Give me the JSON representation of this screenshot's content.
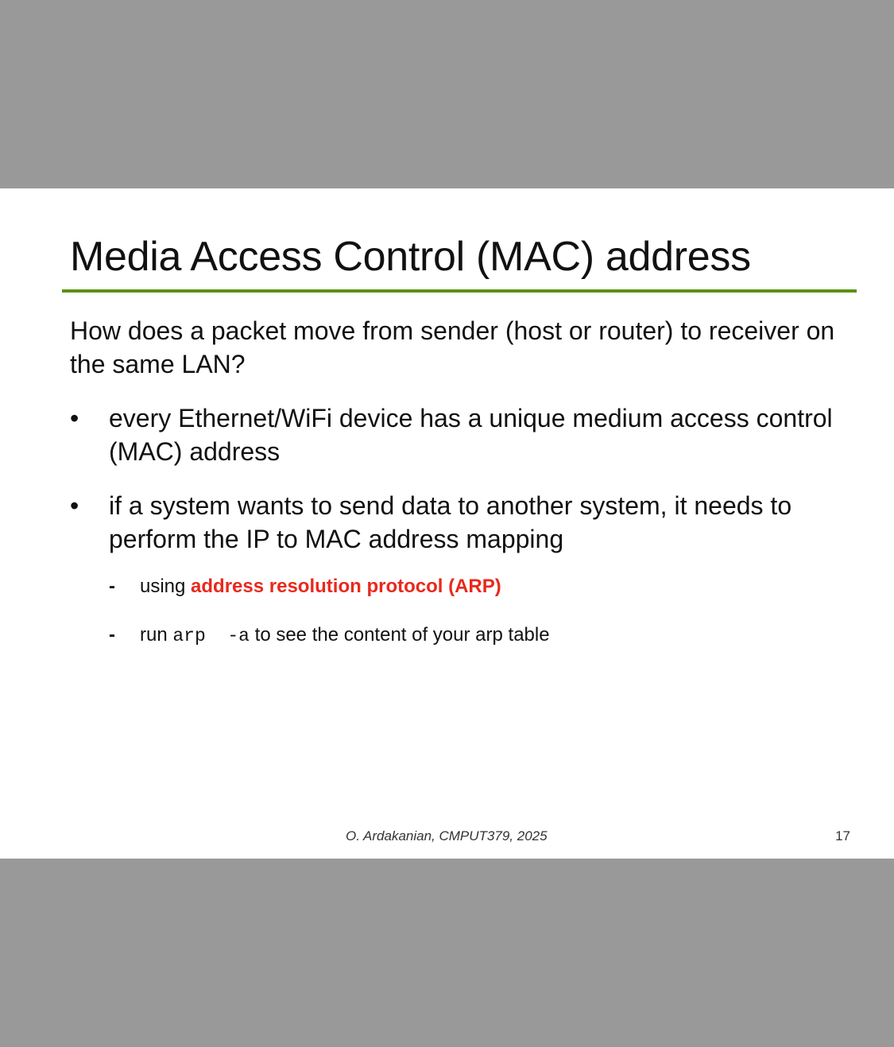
{
  "slide": {
    "title": "Media Access Control (MAC) address",
    "intro": "How does a packet move from sender (host or router) to receiver on the same LAN?",
    "bullets": [
      {
        "marker": "•",
        "text": "every Ethernet/WiFi device has a unique medium access control (MAC) address"
      },
      {
        "marker": "•",
        "text": "if a system wants to send data to another system, it needs to perform the IP to MAC address mapping"
      }
    ],
    "subbullets": [
      {
        "marker": "-",
        "prefix": "using ",
        "highlight": "address resolution protocol (ARP)"
      },
      {
        "marker": "-",
        "prefix": "run ",
        "code": "arp  -a",
        "suffix": " to see the content of your arp table"
      }
    ],
    "footer": {
      "credit": "O. Ardakanian, CMPUT379, 2025",
      "page_number": "17"
    }
  },
  "colors": {
    "background": "#999999",
    "slide": "#ffffff",
    "rule": "#5b9213",
    "highlight": "#e8291c",
    "text": "#111111"
  }
}
